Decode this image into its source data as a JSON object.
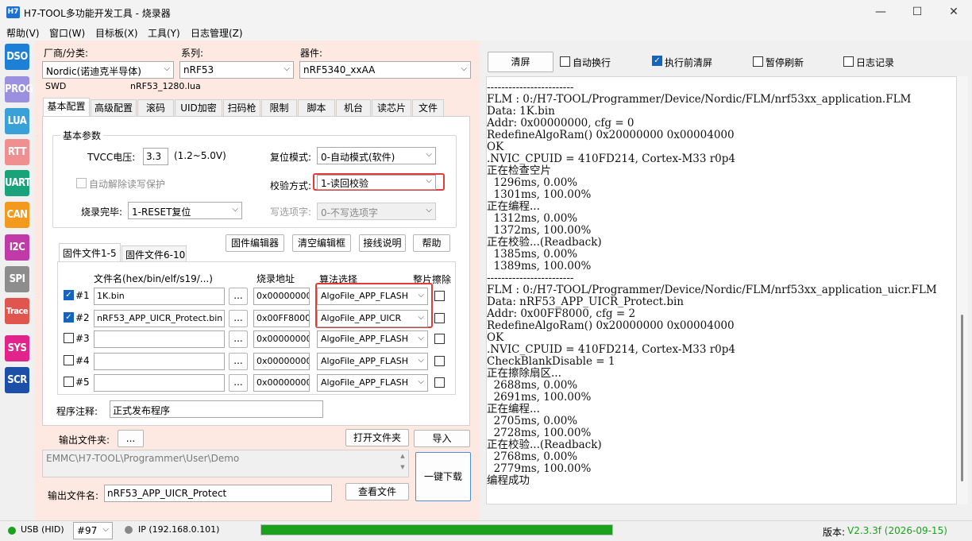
{
  "window": {
    "logo": "H7",
    "title": "H7-TOOL多功能开发工具 - 烧录器",
    "minimize": "—",
    "maximize": "☐",
    "close": "✕"
  },
  "menu": [
    "帮助(V)",
    "窗口(W)",
    "目标板(X)",
    "工具(Y)",
    "日志管理(Z)"
  ],
  "sidebar": [
    {
      "label": "DSO",
      "color": "#1e7fd6"
    },
    {
      "label": "PROG",
      "color": "#9b8fe0"
    },
    {
      "label": "LUA",
      "color": "#3aa0d8"
    },
    {
      "label": "RTT",
      "color": "#f08f8f"
    },
    {
      "label": "UART",
      "color": "#1aa37a"
    },
    {
      "label": "CAN",
      "color": "#f39a1e"
    },
    {
      "label": "I2C",
      "color": "#c03aa8"
    },
    {
      "label": "SPI",
      "color": "#8d8d8d"
    },
    {
      "label": "Trace",
      "color": "#e0554e"
    },
    {
      "label": "SYS",
      "color": "#e0248a"
    },
    {
      "label": "SCR",
      "color": "#1c4fa8"
    }
  ],
  "device": {
    "vendor_label": "厂商/分类:",
    "vendor_value": "Nordic(诺迪克半导体)",
    "series_label": "系列:",
    "series_value": "nRF53",
    "part_label": "器件:",
    "part_value": "nRF5340_xxAA",
    "interface": "SWD",
    "lua_file": "nRF53_1280.lua"
  },
  "tabs": [
    "基本配置",
    "高级配置",
    "滚码",
    "UID加密",
    "扫码枪",
    "限制",
    "脚本",
    "机台",
    "读芯片",
    "文件"
  ],
  "basic": {
    "group_title": "基本参数",
    "tvcc_label": "TVCC电压:",
    "tvcc_value": "3.3",
    "tvcc_range": "(1.2~5.0V)",
    "reset_label": "复位模式:",
    "reset_value": "0-自动模式(软件)",
    "unlock_label": "自动解除读写保护",
    "verify_label": "校验方式:",
    "verify_value": "1-读回校验",
    "done_label": "烧录完毕:",
    "done_value": "1-RESET复位",
    "write_opt_label": "写选项字:",
    "write_opt_value": "0-不写选项字"
  },
  "firmware": {
    "tab1": "固件文件1-5",
    "tab2": "固件文件6-10",
    "btn_editor": "固件编辑器",
    "btn_clear": "清空编辑框",
    "btn_wiring": "接线说明",
    "btn_help": "帮助",
    "col_file": "文件名(hex/bin/elf/s19/...)",
    "col_addr": "烧录地址",
    "col_algo": "算法选择",
    "col_erase": "整片擦除",
    "browse": "...",
    "rows": [
      {
        "idx": "#1",
        "checked": true,
        "file": "1K.bin",
        "addr": "0x00000000",
        "algo": "AlgoFile_APP_FLASH"
      },
      {
        "idx": "#2",
        "checked": true,
        "file": "nRF53_APP_UICR_Protect.bin",
        "addr": "0x00FF8000",
        "algo": "AlgoFile_APP_UICR"
      },
      {
        "idx": "#3",
        "checked": false,
        "file": "",
        "addr": "0x00000000",
        "algo": "AlgoFile_APP_FLASH"
      },
      {
        "idx": "#4",
        "checked": false,
        "file": "",
        "addr": "0x00000000",
        "algo": "AlgoFile_APP_FLASH"
      },
      {
        "idx": "#5",
        "checked": false,
        "file": "",
        "addr": "0x00000000",
        "algo": "AlgoFile_APP_FLASH"
      }
    ],
    "note_label": "程序注释:",
    "note_value": "正式发布程序"
  },
  "output": {
    "folder_label": "输出文件夹:",
    "folder_btn": "...",
    "open_folder": "打开文件夹",
    "import": "导入",
    "path": "EMMC\\H7-TOOL\\Programmer\\User\\Demo",
    "download": "一键下载",
    "name_label": "输出文件名:",
    "name_value": "nRF53_APP_UICR_Protect",
    "view_file": "查看文件"
  },
  "log_toolbar": {
    "clear": "清屏",
    "autowrap": "自动换行",
    "clear_before": "执行前清屏",
    "pause": "暂停刷新",
    "log_record": "日志记录"
  },
  "log": "------------------------\nFLM : 0:/H7-TOOL/Programmer/Device/Nordic/FLM/nrf53xx_application.FLM\nData: 1K.bin\nAddr: 0x00000000, cfg = 0\nRedefineAlgoRam() 0x20000000 0x00004000\nOK\n.NVIC_CPUID = 410FD214, Cortex-M33 r0p4\n正在检查空片\n  1296ms, 0.00%\n  1301ms, 100.00%\n正在编程...\n  1312ms, 0.00%\n  1372ms, 100.00%\n正在校验...(Readback)\n  1385ms, 0.00%\n  1389ms, 100.00%\n------------------------\nFLM : 0:/H7-TOOL/Programmer/Device/Nordic/FLM/nrf53xx_application_uicr.FLM\nData: nRF53_APP_UICR_Protect.bin\nAddr: 0x00FF8000, cfg = 2\nRedefineAlgoRam() 0x20000000 0x00004000\nOK\n.NVIC_CPUID = 410FD214, Cortex-M33 r0p4\nCheckBlankDisable = 1\n正在擦除扇区...\n  2688ms, 0.00%\n  2691ms, 100.00%\n正在编程...\n  2705ms, 0.00%\n  2728ms, 100.00%\n正在校验...(Readback)\n  2768ms, 0.00%\n  2779ms, 100.00%\n编程成功",
  "status": {
    "usb": "USB (HID)",
    "device_no": "#97",
    "ip": "IP (192.168.0.101)",
    "progress": 1.0,
    "version_label": "版本: ",
    "version_value": "V2.3.3f (2026-09-15)",
    "green": "#1aa31a"
  }
}
